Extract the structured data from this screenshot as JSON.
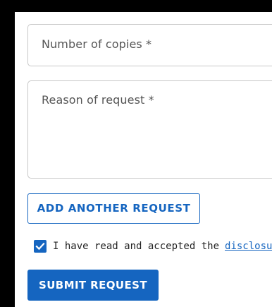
{
  "form": {
    "copies_field": {
      "placeholder": "Number of copies *"
    },
    "reason_field": {
      "placeholder": "Reason of request *"
    },
    "add_request_label": "ADD ANOTHER REQUEST",
    "consent": {
      "checked": true,
      "text": "I have read and accepted the",
      "link_text": "disclosure"
    },
    "submit_label": "SUBMIT REQUEST"
  },
  "colors": {
    "accent": "#1565c0",
    "border": "#c7c7c7",
    "placeholder_text": "#555555",
    "background": "#ffffff",
    "outer_frame": "#000000"
  },
  "icons": {
    "checkbox_mark": "check-icon"
  }
}
